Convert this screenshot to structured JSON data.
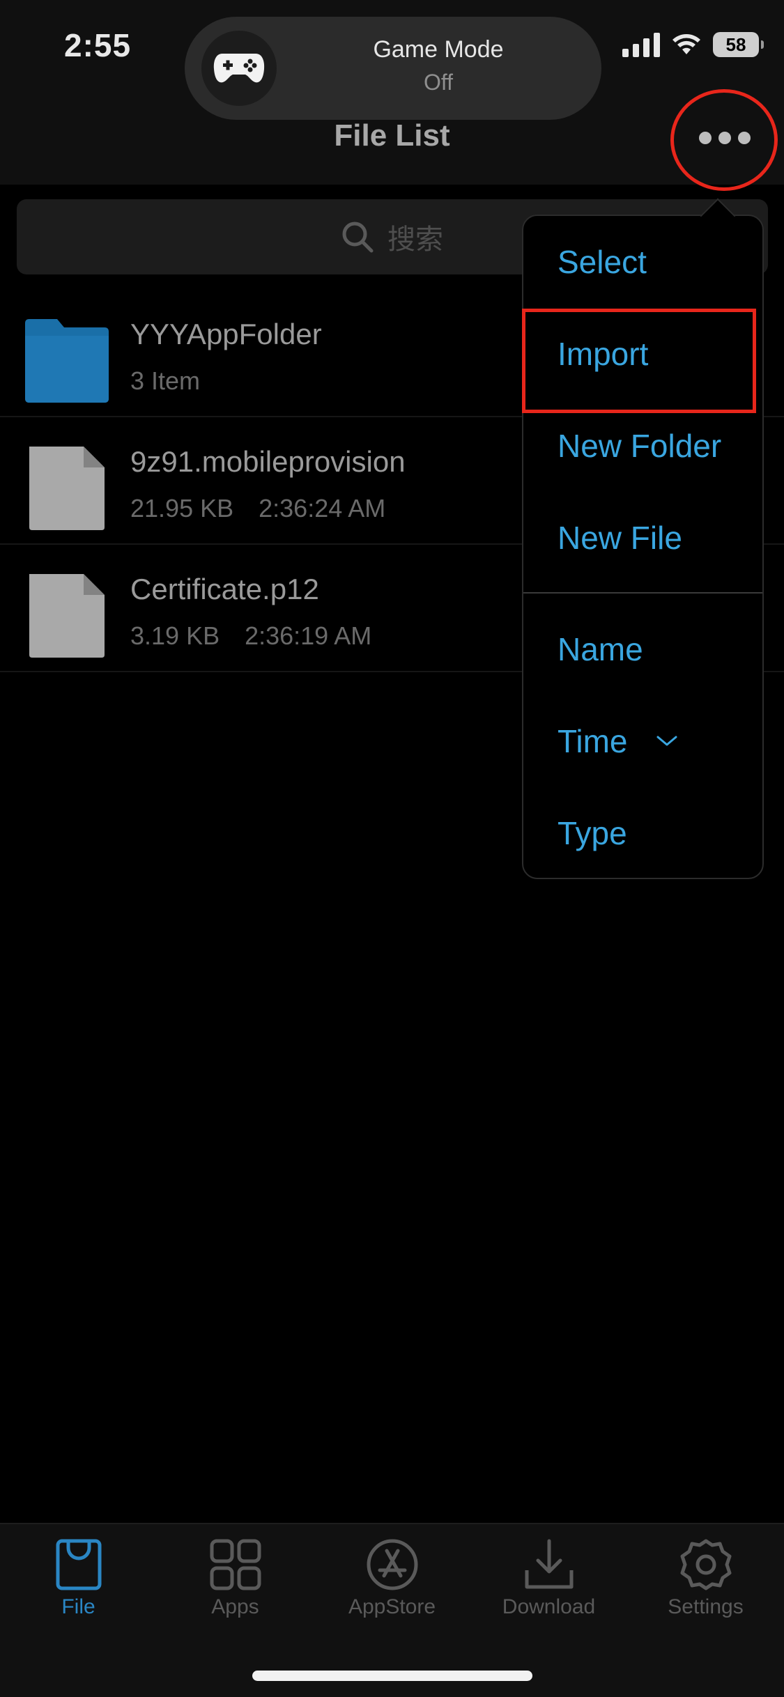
{
  "status_bar": {
    "time": "2:55",
    "battery": "58"
  },
  "game_mode": {
    "title": "Game Mode",
    "status": "Off"
  },
  "header": {
    "title": "File List",
    "more_icon": "ellipsis-icon"
  },
  "search": {
    "placeholder": "搜索"
  },
  "files": [
    {
      "name": "YYYAppFolder",
      "meta1": "3 Item",
      "meta2": "",
      "kind": "folder"
    },
    {
      "name": "9z91.mobileprovision",
      "meta1": "21.95 KB",
      "meta2": "2:36:24 AM",
      "kind": "file"
    },
    {
      "name": "Certificate.p12",
      "meta1": "3.19 KB",
      "meta2": "2:36:19 AM",
      "kind": "file"
    }
  ],
  "menu": {
    "select": "Select",
    "import": "Import",
    "new_folder": "New Folder",
    "new_file": "New File",
    "sort_name": "Name",
    "sort_time": "Time",
    "sort_type": "Type",
    "active_sort": "Time"
  },
  "tabs": [
    {
      "label": "File",
      "icon": "file-bag-icon",
      "active": true
    },
    {
      "label": "Apps",
      "icon": "grid-icon",
      "active": false
    },
    {
      "label": "AppStore",
      "icon": "appstore-icon",
      "active": false
    },
    {
      "label": "Download",
      "icon": "download-icon",
      "active": false
    },
    {
      "label": "Settings",
      "icon": "gear-icon",
      "active": false
    }
  ],
  "colors": {
    "accent": "#3aa6e0",
    "highlight": "#e8261b",
    "tab_active": "#2a86c4",
    "folder": "#1f78b4"
  }
}
